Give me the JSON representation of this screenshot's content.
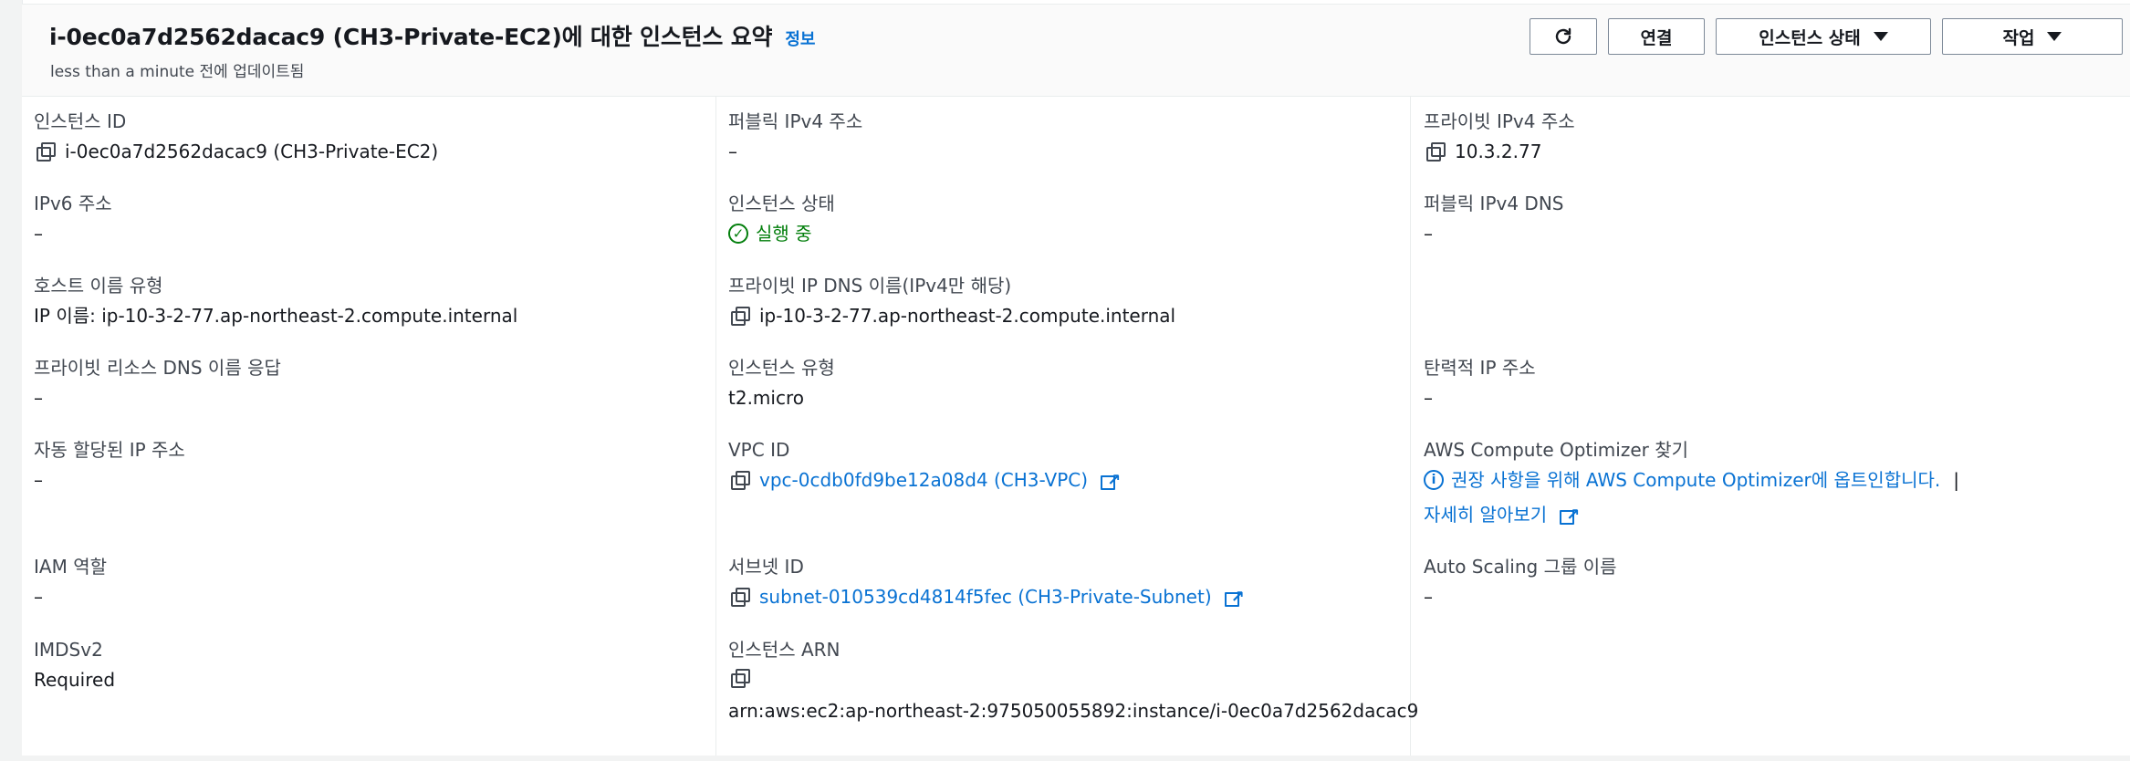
{
  "header": {
    "title": "i-0ec0a7d2562dacac9 (CH3-Private-EC2)에 대한 인스턴스 요약",
    "info": "정보",
    "updated": "less than a minute 전에 업데이트됨",
    "buttons": {
      "connect": "연결",
      "instance_state": "인스턴스 상태",
      "actions": "작업"
    }
  },
  "fields": {
    "instance_id": {
      "label": "인스턴스 ID",
      "value": "i-0ec0a7d2562dacac9 (CH3-Private-EC2)"
    },
    "public_ipv4": {
      "label": "퍼블릭 IPv4 주소",
      "value": "–"
    },
    "private_ipv4": {
      "label": "프라이빗 IPv4 주소",
      "value": "10.3.2.77"
    },
    "ipv6": {
      "label": "IPv6 주소",
      "value": "–"
    },
    "instance_state": {
      "label": "인스턴스 상태",
      "value": "실행 중"
    },
    "public_dns": {
      "label": "퍼블릭 IPv4 DNS",
      "value": "–"
    },
    "hostname_type": {
      "label": "호스트 이름 유형",
      "value": "IP 이름: ip-10-3-2-77.ap-northeast-2.compute.internal"
    },
    "private_ip_dns": {
      "label": "프라이빗 IP DNS 이름(IPv4만 해당)",
      "value": "ip-10-3-2-77.ap-northeast-2.compute.internal"
    },
    "private_resource_dns": {
      "label": "프라이빗 리소스 DNS 이름 응답",
      "value": "–"
    },
    "instance_type": {
      "label": "인스턴스 유형",
      "value": "t2.micro"
    },
    "elastic_ip": {
      "label": "탄력적 IP 주소",
      "value": "–"
    },
    "auto_assigned_ip": {
      "label": "자동 할당된 IP 주소",
      "value": "–"
    },
    "vpc_id": {
      "label": "VPC ID",
      "value": "vpc-0cdb0fd9be12a08d4 (CH3-VPC)"
    },
    "compute_optimizer": {
      "label": "AWS Compute Optimizer 찾기",
      "note": "권장 사항을 위해 AWS Compute Optimizer에 옵트인합니다.",
      "separator": "|",
      "learn_more": "자세히 알아보기"
    },
    "iam_role": {
      "label": "IAM 역할",
      "value": "–"
    },
    "subnet_id": {
      "label": "서브넷 ID",
      "value": "subnet-010539cd4814f5fec (CH3-Private-Subnet)"
    },
    "auto_scaling": {
      "label": "Auto Scaling 그룹 이름",
      "value": "–"
    },
    "imdsv2": {
      "label": "IMDSv2",
      "value": "Required"
    },
    "instance_arn": {
      "label": "인스턴스 ARN",
      "value": "arn:aws:ec2:ap-northeast-2:975050055892:instance/i-0ec0a7d2562dacac9"
    }
  }
}
